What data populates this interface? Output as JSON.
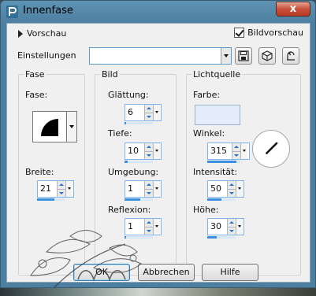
{
  "window": {
    "title": "Innenfase",
    "close_label": "x"
  },
  "header": {
    "preview_label": "Vorschau",
    "bild_preview_label": "Bildvorschau",
    "bild_preview_checked": true
  },
  "settings": {
    "label": "Einstellungen",
    "value": ""
  },
  "groups": {
    "bevel": {
      "title": "Bild",
      "shape_label": "Fase:",
      "width_label": "Breite:",
      "width_value": "21",
      "width_fill": 0.6
    },
    "bild": {
      "title": "Bild",
      "smoothness_label": "Glättung:",
      "smoothness_value": "6",
      "smoothness_fill": 0.06,
      "depth_label": "Tiefe:",
      "depth_value": "10",
      "depth_fill": 0.1,
      "ambience_label": "Umgebung:",
      "ambience_value": "1",
      "ambience_fill": 0.55,
      "reflection_label": "Reflexion:",
      "reflection_value": "1",
      "reflection_fill": 0.01
    },
    "light": {
      "title": "Lichtquelle",
      "color_label": "Farbe:",
      "color_value": "#e5edfb",
      "angle_label": "Winkel:",
      "angle_value": "315",
      "angle_fill": 0.88,
      "intensity_label": "Intensität:",
      "intensity_value": "50",
      "intensity_fill": 0.5,
      "height_label": "Höhe:",
      "height_value": "30",
      "height_fill": 0.33
    }
  },
  "footer": {
    "ok": "OK",
    "cancel": "Abbrechen",
    "help": "Hilfe"
  },
  "colors": {
    "accent": "#3a8fe0",
    "close_red": "#c9503a"
  }
}
